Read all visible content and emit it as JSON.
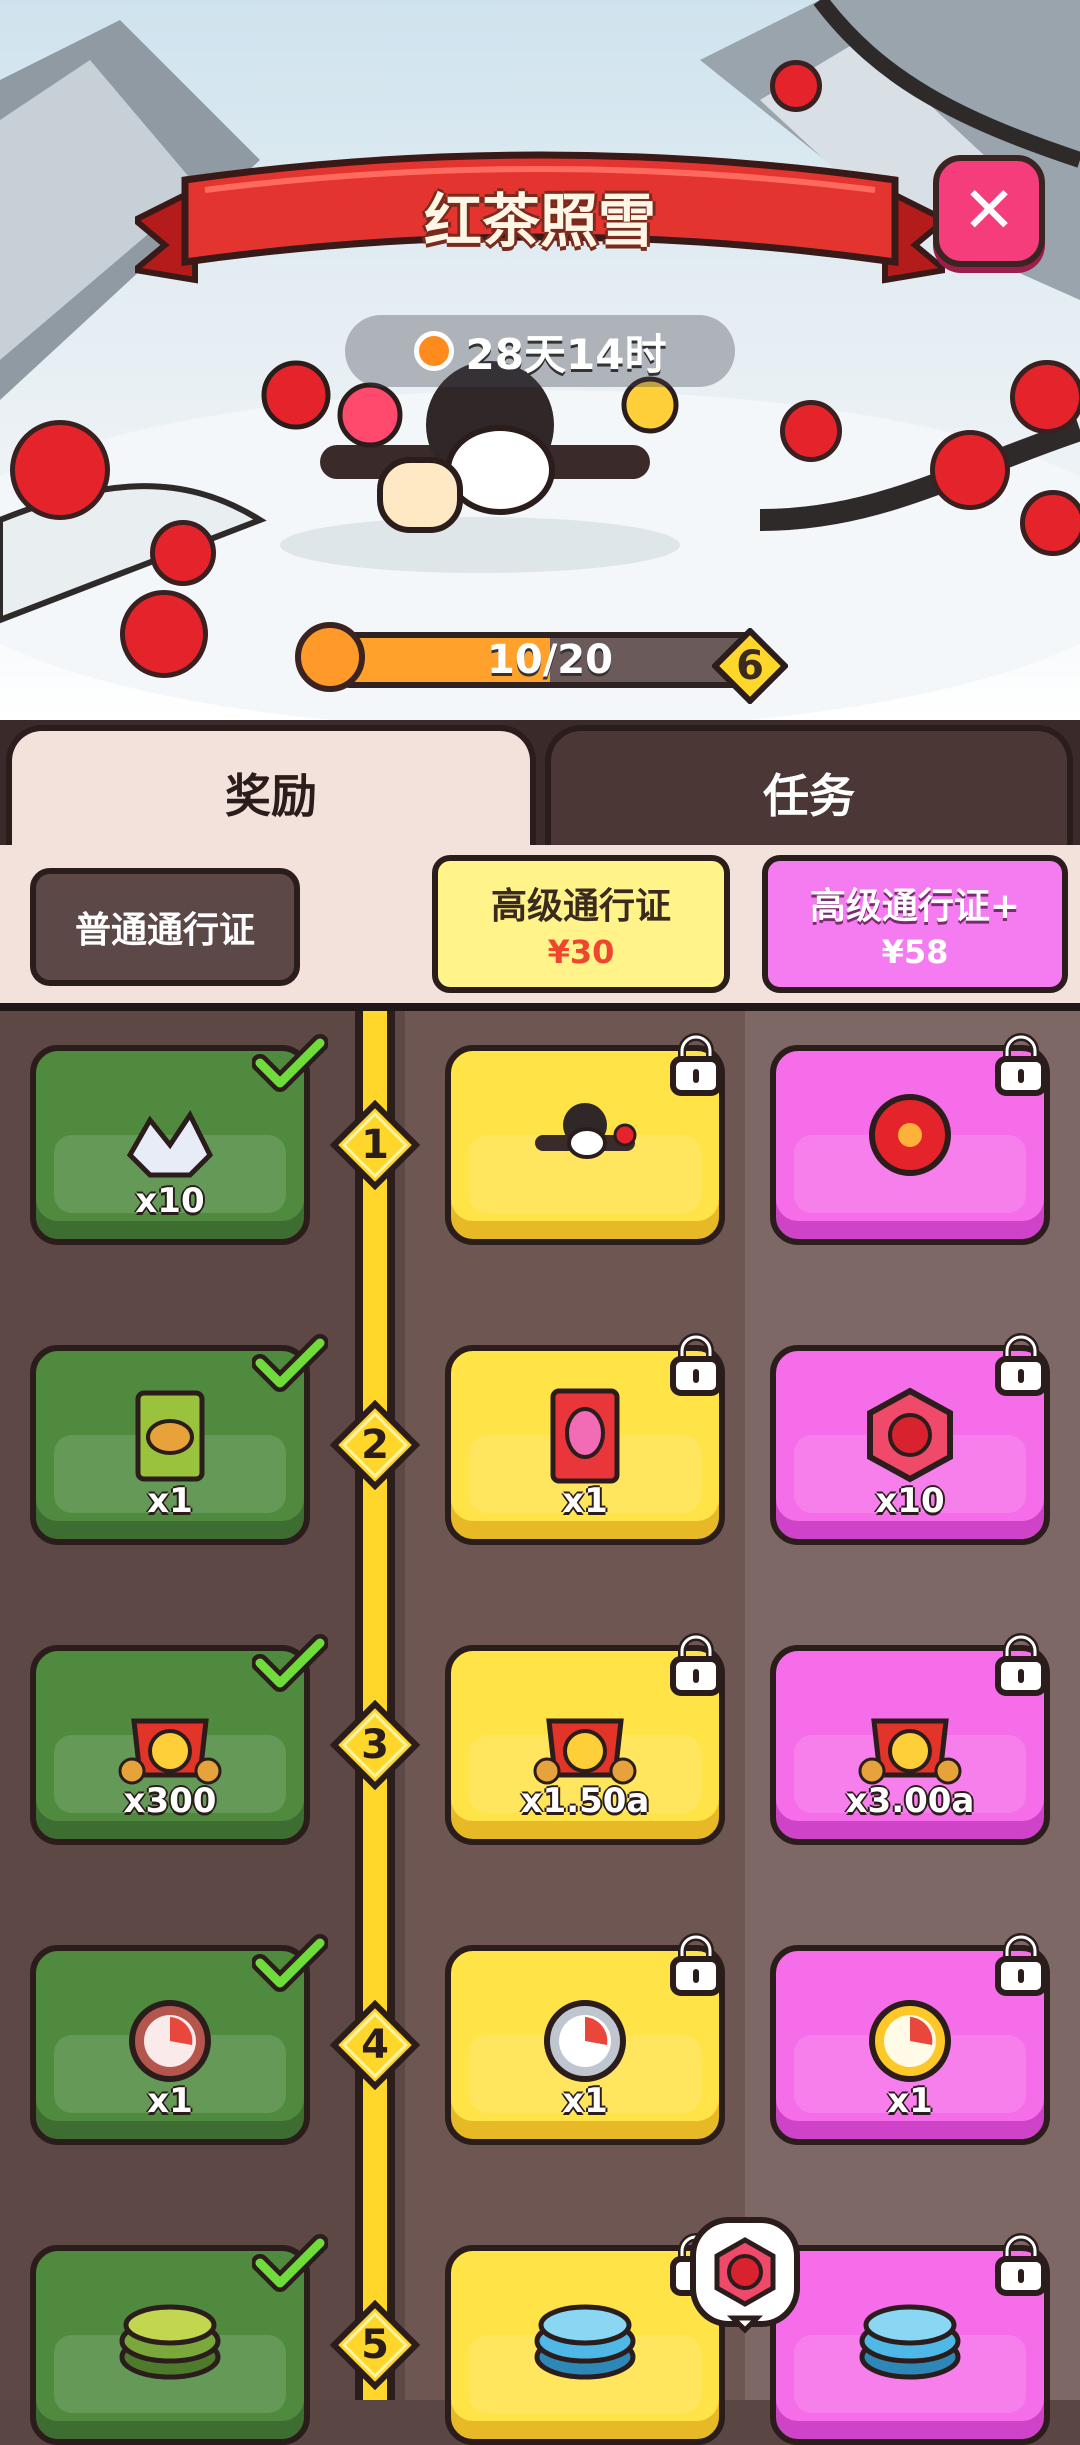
{
  "event": {
    "title": "红茶照雪",
    "countdown": "28天14时",
    "progress_text": "10/20",
    "progress_fraction": 0.5,
    "level": "6"
  },
  "tabs": [
    {
      "label": "奖励",
      "active": true
    },
    {
      "label": "任务",
      "active": false
    }
  ],
  "passes": {
    "normal": {
      "label": "普通通行证"
    },
    "premium": {
      "label": "高级通行证",
      "price": "¥30"
    },
    "premium_plus": {
      "label": "高级通行证+",
      "price": "¥58"
    }
  },
  "rows": [
    {
      "level": "1",
      "free": {
        "icon": "crystal-pile-icon",
        "qty": "x10",
        "claimed": true
      },
      "premium": {
        "icon": "character-skin-icon",
        "qty": "",
        "locked": true
      },
      "plus": {
        "icon": "camellia-flower-icon",
        "qty": "",
        "locked": true
      }
    },
    {
      "level": "2",
      "free": {
        "icon": "seed-packet-icon",
        "qty": "x1",
        "claimed": true
      },
      "premium": {
        "icon": "dragonfruit-seed-packet-icon",
        "qty": "x1",
        "locked": true
      },
      "plus": {
        "icon": "flower-badge-icon",
        "qty": "x10",
        "locked": true
      }
    },
    {
      "level": "3",
      "free": {
        "icon": "coin-bag-icon",
        "qty": "x300",
        "claimed": true
      },
      "premium": {
        "icon": "coin-bag-icon",
        "qty": "x1.50a",
        "locked": true
      },
      "plus": {
        "icon": "coin-bag-icon",
        "qty": "x3.00a",
        "locked": true
      }
    },
    {
      "level": "4",
      "free": {
        "icon": "bronze-stopwatch-icon",
        "qty": "x1",
        "claimed": true
      },
      "premium": {
        "icon": "silver-stopwatch-icon",
        "qty": "x1",
        "locked": true
      },
      "plus": {
        "icon": "gold-stopwatch-icon",
        "qty": "x1",
        "locked": true
      }
    },
    {
      "level": "5",
      "free": {
        "icon": "green-token-stack-icon",
        "qty": "",
        "claimed": true
      },
      "premium": {
        "icon": "blue-token-stack-icon",
        "qty": "",
        "locked": true
      },
      "plus": {
        "icon": "blue-token-stack-icon",
        "qty": "",
        "locked": true
      }
    }
  ],
  "colors": {
    "accent_red": "#e4342f",
    "free_green": "#4f8a3f",
    "premium_gold": "#ffe347",
    "plus_pink": "#f56de8",
    "close_pink": "#f43d7a"
  }
}
